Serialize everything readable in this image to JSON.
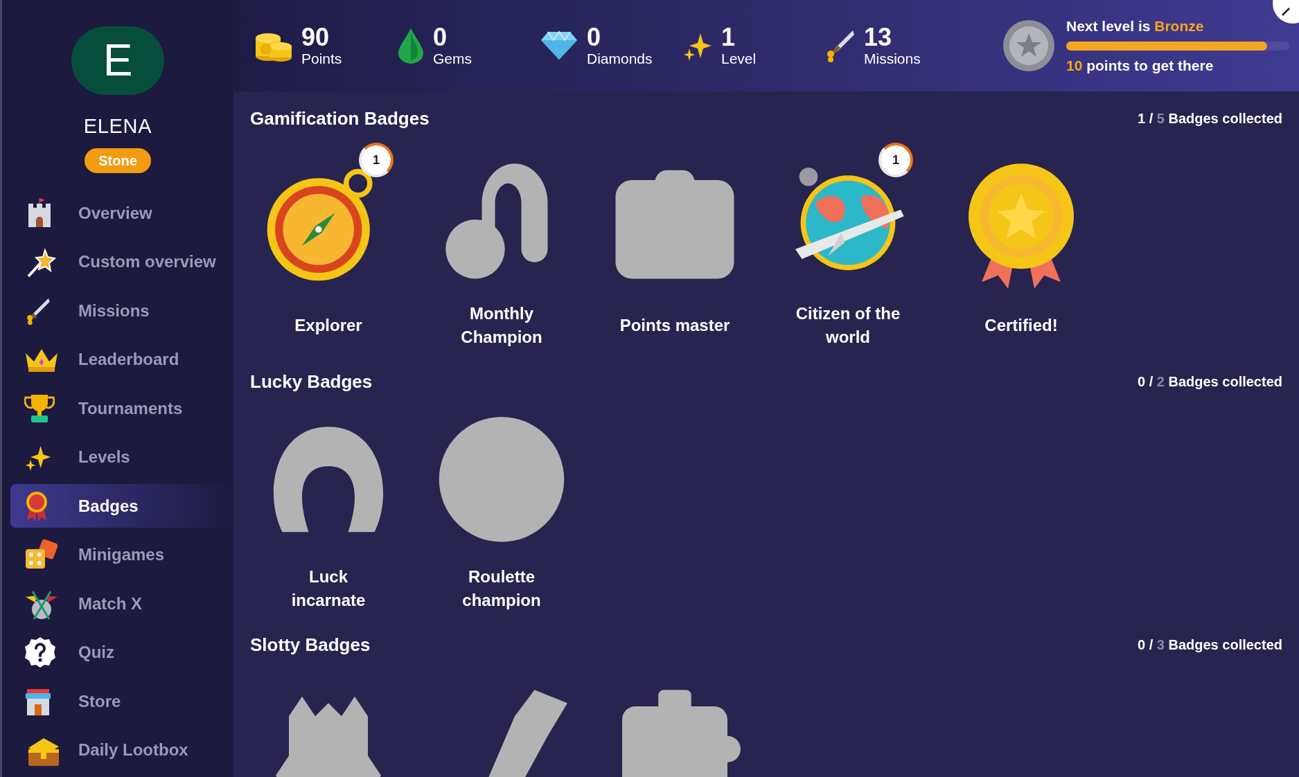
{
  "profile": {
    "initial": "E",
    "name": "ELENA",
    "rank": "Stone"
  },
  "stats": [
    {
      "value": "90",
      "label": "Points"
    },
    {
      "value": "0",
      "label": "Gems"
    },
    {
      "value": "0",
      "label": "Diamonds"
    },
    {
      "value": "1",
      "label": "Level"
    },
    {
      "value": "13",
      "label": "Missions"
    }
  ],
  "next_level": {
    "prefix": "Next level is",
    "level_name": "Bronze",
    "level": 0.9,
    "points": "10",
    "suffix": "points to get there"
  },
  "sidebar": {
    "items": [
      {
        "label": "Overview",
        "selected": false
      },
      {
        "label": "Custom overview",
        "selected": false
      },
      {
        "label": "Missions",
        "selected": false
      },
      {
        "label": "Leaderboard",
        "selected": false
      },
      {
        "label": "Tournaments",
        "selected": false
      },
      {
        "label": "Levels",
        "selected": false
      },
      {
        "label": "Badges",
        "selected": true
      },
      {
        "label": "Minigames",
        "selected": false
      },
      {
        "label": "Match X",
        "selected": false
      },
      {
        "label": "Quiz",
        "selected": false
      },
      {
        "label": "Store",
        "selected": false
      },
      {
        "label": "Daily Lootbox",
        "selected": false
      }
    ]
  },
  "sections": [
    {
      "title": "Gamification Badges",
      "collected": "1",
      "separator": "/",
      "total": "5",
      "suffix": "Badges collected",
      "badges": [
        {
          "name": "Explorer",
          "unlocked": true,
          "count": "1"
        },
        {
          "name": "Monthly Champion",
          "unlocked": false
        },
        {
          "name": "Points master",
          "unlocked": false
        },
        {
          "name": "Citizen of the world",
          "unlocked": true,
          "count": "1"
        },
        {
          "name": "Certified!",
          "unlocked": true
        }
      ]
    },
    {
      "title": "Lucky Badges",
      "collected": "0",
      "separator": "/",
      "total": "2",
      "suffix": "Badges collected",
      "badges": [
        {
          "name": "Luck incarnate",
          "unlocked": false
        },
        {
          "name": "Roulette champion",
          "unlocked": false
        }
      ]
    },
    {
      "title": "Slotty Badges",
      "collected": "0",
      "separator": "/",
      "total": "3",
      "suffix": "Badges collected",
      "badges": [
        {
          "unlocked": false
        },
        {
          "unlocked": false
        },
        {
          "unlocked": false
        }
      ]
    }
  ]
}
